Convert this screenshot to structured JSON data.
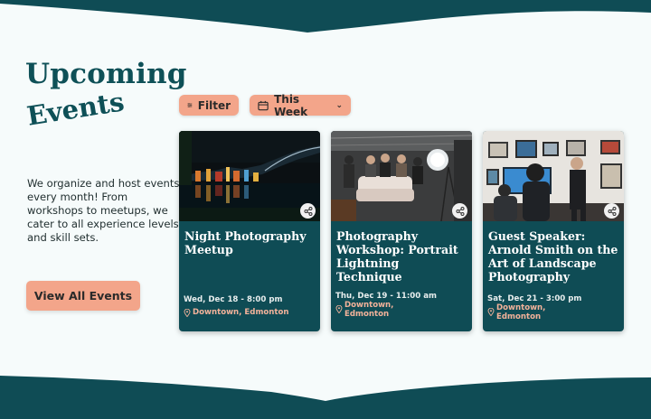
{
  "heading": {
    "line1": "Upcoming",
    "line2": "Events"
  },
  "intro": "We organize and host events every month! From workshops to meetups, we cater to all experience levels and skill sets.",
  "view_all_label": "View All Events",
  "filters": {
    "filter_label": "Filter",
    "range_label": "This Week",
    "range_chevron": "⌄"
  },
  "colors": {
    "primary": "#0f4c55",
    "accent": "#f3a58a",
    "background": "#f6fbfb"
  },
  "events": [
    {
      "title": "Night Photography Meetup",
      "date": "Wed, Dec 18 - 8:00 pm",
      "location": "Downtown, Edmonton"
    },
    {
      "title": "Photography Workshop: Portrait Lightning Technique",
      "date": "Thu, Dec 19 - 11:00 am",
      "location": "Downtown, Edmonton"
    },
    {
      "title": "Guest Speaker: Arnold Smith on the Art of Landscape Photography",
      "date": "Sat, Dec 21 - 3:00 pm",
      "location": "Downtown, Edmonton"
    }
  ]
}
